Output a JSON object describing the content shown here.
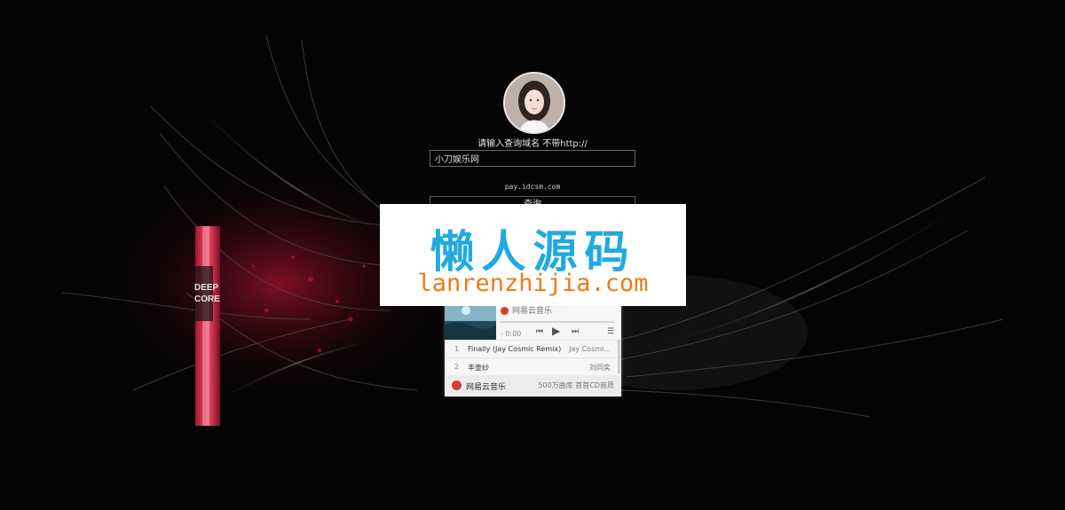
{
  "form": {
    "prompt": "请输入查询域名 不带http://",
    "domain_value": "小刀娱乐网",
    "site": "pay.idcsm.com",
    "query_button": "查询"
  },
  "music_player": {
    "provider": "网易云音乐",
    "time": "- 0:00",
    "tracks": [
      {
        "num": "1",
        "title": "Finally (Jay Cosmic Remix)",
        "artist": "Jay Cosmi..."
      },
      {
        "num": "2",
        "title": "丰壶纱",
        "artist": "刘同奕"
      }
    ],
    "footer": {
      "name": "网易云音乐",
      "slogan": "500万曲库 首首CD音质"
    }
  },
  "watermark": {
    "title": "懒人源码",
    "domain": "lanrenzhijia.com"
  },
  "poster_text": "DEEP\nCORE",
  "colors": {
    "watermark_blue": "#21a9e1",
    "watermark_orange": "#f07a13",
    "player_red": "#d73b31"
  }
}
